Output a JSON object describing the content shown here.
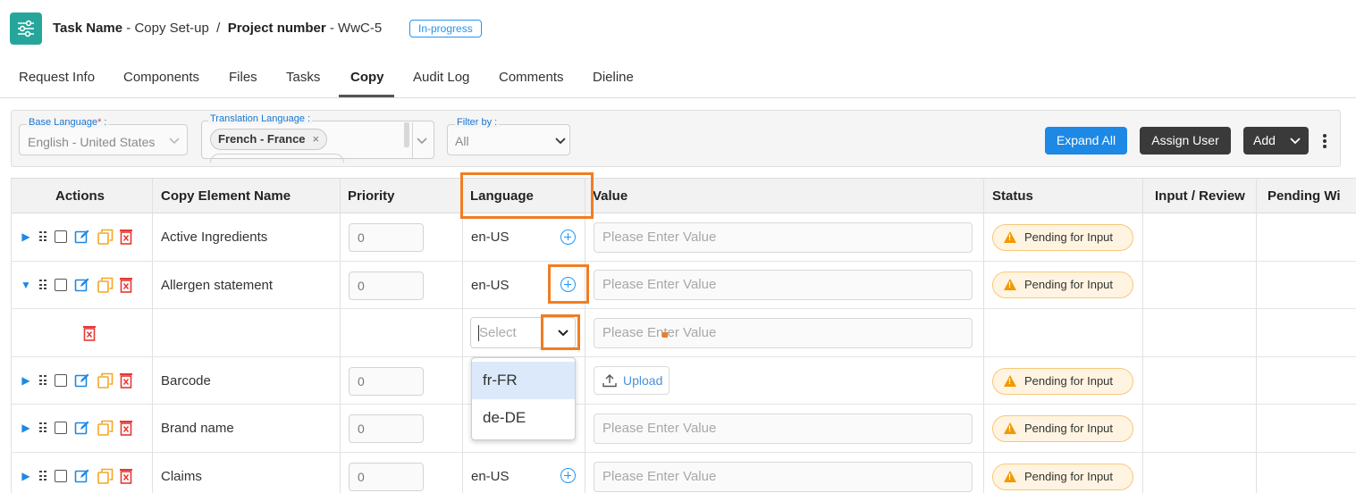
{
  "header": {
    "task_label": "Task Name",
    "task_value": "- Copy Set-up",
    "separator": "/",
    "project_label": "Project number",
    "project_value": "- WwC-5",
    "status": "In-progress"
  },
  "tabs": [
    "Request Info",
    "Components",
    "Files",
    "Tasks",
    "Copy",
    "Audit Log",
    "Comments",
    "Dieline"
  ],
  "active_tab": "Copy",
  "filters": {
    "base_language_label": "Base Language",
    "base_language_required": "*",
    "base_language_suffix": ":",
    "base_language_value": "English - United States",
    "translation_language_label": "Translation Language :",
    "translation_language_chip": "French - France",
    "chip_remove": "×",
    "filter_by_label": "Filter by :",
    "filter_by_value": "All"
  },
  "toolbar": {
    "expand_all": "Expand All",
    "assign_user": "Assign User",
    "add": "Add"
  },
  "table": {
    "columns": [
      "Actions",
      "Copy Element Name",
      "Priority",
      "Language",
      "Value",
      "Status",
      "Input / Review",
      "Pending Wi"
    ],
    "rows": [
      {
        "name": "Active Ingredients",
        "priority": "0",
        "language": "en-US",
        "value_placeholder": "Please Enter Value",
        "status": "Pending for Input"
      },
      {
        "name": "Allergen statement",
        "priority": "0",
        "language": "en-US",
        "value_placeholder": "Please Enter Value",
        "status": "Pending for Input"
      },
      {
        "name": "Barcode",
        "priority": "0",
        "upload_label": "Upload",
        "status": "Pending for Input"
      },
      {
        "name": "Brand name",
        "priority": "0",
        "value_placeholder": "Please Enter Value",
        "status": "Pending for Input"
      },
      {
        "name": "Claims",
        "priority": "0",
        "language": "en-US",
        "value_placeholder": "Please Enter Value",
        "status": "Pending for Input"
      }
    ],
    "subrow": {
      "select_placeholder": "Select",
      "value_placeholder": "Please Enter Value"
    }
  },
  "dropdown": {
    "options": [
      "fr-FR",
      "de-DE"
    ],
    "highlighted": "fr-FR"
  },
  "colors": {
    "accent": "#1e88e5",
    "highlight_box": "#f07d22",
    "app_icon": "#26a69a",
    "pending_bg": "#fff4e1"
  }
}
